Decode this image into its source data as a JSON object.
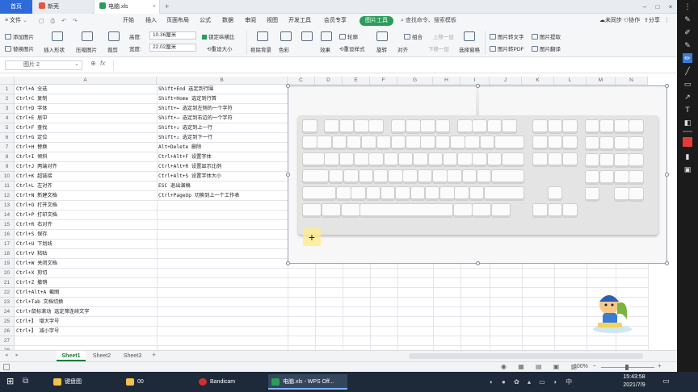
{
  "tabs": {
    "home": "首页",
    "new": "新壳",
    "doc": "电脑.xls"
  },
  "menu": {
    "file": "文件",
    "items": [
      "开始",
      "插入",
      "页面布局",
      "公式",
      "数据",
      "审阅",
      "视图",
      "开发工具",
      "会员专享"
    ],
    "active": "图片工具",
    "search": "查找命令、搜索模板",
    "right": [
      "未同步",
      "协作",
      "分享"
    ]
  },
  "ribbon": {
    "add_picture": "添加图片",
    "replace_picture": "替换图片",
    "insert_shape": "插入形状",
    "compress": "压缩图片",
    "crop": "裁剪",
    "height_label": "高度:",
    "height_value": "10.36厘米",
    "width_label": "宽度:",
    "width_value": "22.02厘米",
    "lock_ratio": "锁定纵横比",
    "reset_size": "重设大小",
    "remove_bg": "抠除背景",
    "color": "色彩",
    "effects": "效果",
    "reset_style": "重设样式",
    "rotate": "旋转",
    "align": "对齐",
    "outline": "轮廓",
    "group": "组合",
    "up": "上移一层",
    "down": "下移一层",
    "selection_pane": "选择窗格",
    "to_text": "图片转文字",
    "to_pdf": "图片转PDF",
    "extract": "图片提取",
    "translate": "图片翻译"
  },
  "formula_bar": {
    "name_box": "图片 2",
    "fx": "fx"
  },
  "columns": [
    "A",
    "B",
    "C",
    "D",
    "E",
    "F",
    "G",
    "H",
    "I",
    "J",
    "K",
    "L",
    "M",
    "N"
  ],
  "rows": [
    "1",
    "2",
    "3",
    "4",
    "5",
    "6",
    "7",
    "8",
    "9",
    "10",
    "11",
    "12",
    "13",
    "14",
    "15",
    "16",
    "17",
    "18",
    "19",
    "20",
    "21",
    "22",
    "23",
    "24",
    "25",
    "26",
    "27",
    "28"
  ],
  "col_a": [
    "Ctrl+A      全选",
    "Ctrl+C        复制",
    "Ctrl+D      字体",
    "Ctrl+E        居中",
    "Ctrl+F          查找",
    "Ctrl+G        定位",
    "Ctrl+H         替换",
    "Ctrl+I        倾斜",
    "Ctrl+J        两端对齐",
    "Ctrl+K      超链接",
    "Ctrl+L        左对齐",
    "Ctrl+N      新建文档",
    "Ctrl+O    打开文档",
    "Ctrl+P      打印文档",
    "Ctrl+R        右对齐",
    "Ctrl+S        保存",
    "Ctrl+U     下划线",
    "Ctrl+V      粘贴",
    "Ctrl+W   关闭文档",
    "Ctrl+X       剪切",
    "Ctrl+Z      撤销",
    "Ctrl+Alt+A   截图",
    "Ctrl+Tab    文档切换",
    "Ctrl+鼠标滚动   选定筛连续文字",
    "Ctrl+】   增大字号",
    "Ctrl+】   减小字号"
  ],
  "col_b": [
    "Shift+End    选定到行围",
    "Shift+Home   选定到行首",
    "Shift+←   选定到左侧的一个字符",
    "Shift+→   选定到右边的一个字符",
    "Shift+↓    选定到上一行",
    "Shift+↓    选定到下一行",
    "Alt+Delete   删除",
    "Ctrl+Alt+F   设置字体",
    "Ctrl+Alt+R   设置显示比例",
    "Ctrl+Alt+S    设置字体大小",
    "ESC     退出演稿",
    "Ctrl+PageUp   切换到上一个工作表"
  ],
  "sheets": [
    "Sheet1",
    "Sheet2",
    "Sheet3"
  ],
  "status": {
    "zoom": "100%"
  },
  "taskbar": {
    "apps": [
      "键盘图",
      "00",
      "Bandicam",
      "电脑.xls - WPS Off..."
    ],
    "time": "15:43:58",
    "date": "2021/7/9"
  }
}
